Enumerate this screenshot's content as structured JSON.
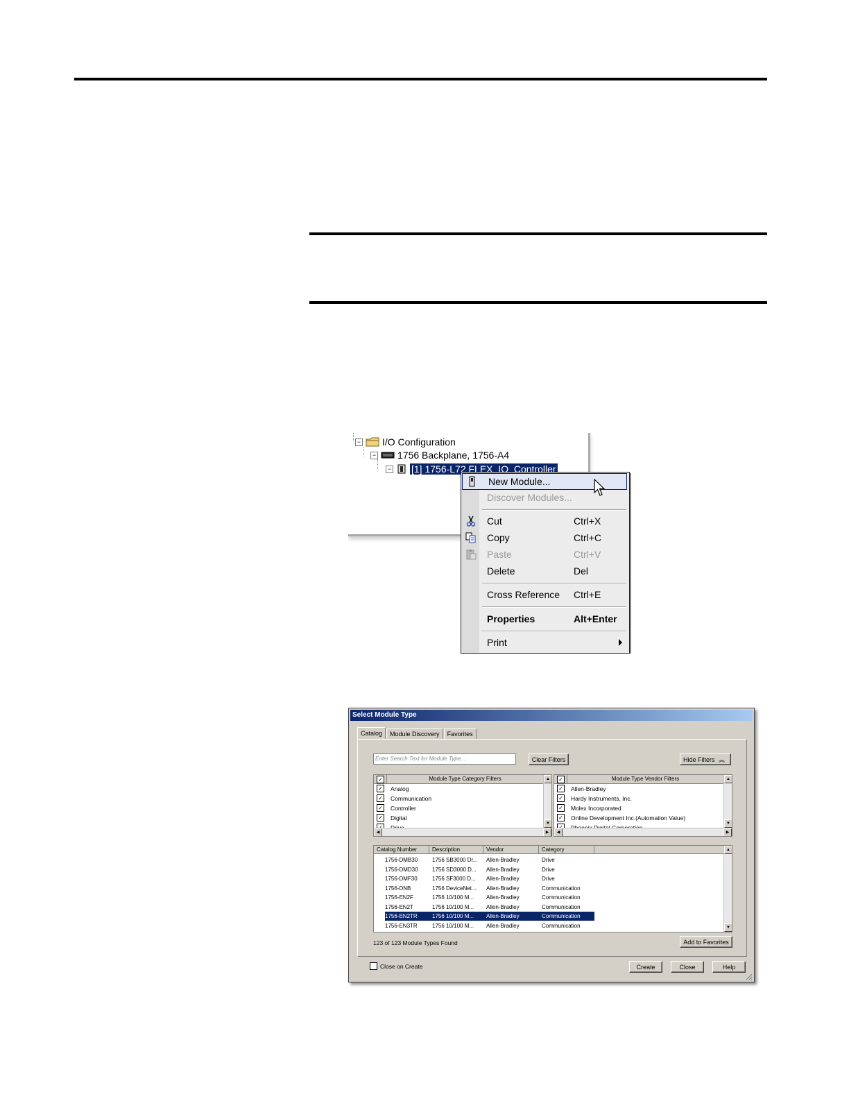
{
  "tree": {
    "items": [
      {
        "label": "I/O Configuration"
      },
      {
        "label": "1756 Backplane, 1756-A4"
      },
      {
        "label": "[1] 1756-L72 FLEX_IO_Controller"
      }
    ]
  },
  "context_menu": {
    "items": [
      {
        "label": "New Module...",
        "shortcut": ""
      },
      {
        "label": "Discover Modules...",
        "shortcut": ""
      },
      {
        "label": "Cut",
        "shortcut": "Ctrl+X"
      },
      {
        "label": "Copy",
        "shortcut": "Ctrl+C"
      },
      {
        "label": "Paste",
        "shortcut": "Ctrl+V"
      },
      {
        "label": "Delete",
        "shortcut": "Del"
      },
      {
        "label": "Cross Reference",
        "shortcut": "Ctrl+E"
      },
      {
        "label": "Properties",
        "shortcut": "Alt+Enter"
      },
      {
        "label": "Print",
        "shortcut": ""
      }
    ]
  },
  "dialog": {
    "title": "Select Module Type",
    "tabs": [
      "Catalog",
      "Module Discovery",
      "Favorites"
    ],
    "search_placeholder": "Enter Search Text for Module Type...",
    "clear_filters": "Clear Filters",
    "hide_filters": "Hide Filters",
    "category_filters": {
      "title": "Module Type Category Filters",
      "items": [
        "Analog",
        "Communication",
        "Controller",
        "Digital",
        "Drive"
      ]
    },
    "vendor_filters": {
      "title": "Module Type Vendor Filters",
      "items": [
        "Allen-Bradley",
        "Hardy Instruments, Inc.",
        "Molex Incorporated",
        "Online Development Inc.(Automation Value)",
        "Phoenix Digital Corporation"
      ]
    },
    "table": {
      "columns": [
        "Catalog Number",
        "Description",
        "Vendor",
        "Category"
      ],
      "rows": [
        [
          "1756-DMB30",
          "1756 SB3000 Dr...",
          "Allen-Bradley",
          "Drive"
        ],
        [
          "1756-DMD30",
          "1756 SD3000 D...",
          "Allen-Bradley",
          "Drive"
        ],
        [
          "1756-DMF30",
          "1756 SF3000 D...",
          "Allen-Bradley",
          "Drive"
        ],
        [
          "1756-DNB",
          "1756 DeviceNet...",
          "Allen-Bradley",
          "Communication"
        ],
        [
          "1756-EN2F",
          "1756 10/100 M...",
          "Allen-Bradley",
          "Communication"
        ],
        [
          "1756-EN2T",
          "1756 10/100 M...",
          "Allen-Bradley",
          "Communication"
        ],
        [
          "1756-EN2TR",
          "1756 10/100 M...",
          "Allen-Bradley",
          "Communication"
        ],
        [
          "1756-EN3TR",
          "1756 10/100 M...",
          "Allen-Bradley",
          "Communication"
        ]
      ],
      "selected_row": 6
    },
    "status": "123  of 123 Module Types Found",
    "add_to_favorites": "Add to Favorites",
    "close_on_create": "Close on Create",
    "buttons": {
      "create": "Create",
      "close": "Close",
      "help": "Help"
    }
  },
  "colors": {
    "selection": "#0a246a",
    "dialog_face": "#d4d0c8",
    "menu_face": "#ececec"
  }
}
